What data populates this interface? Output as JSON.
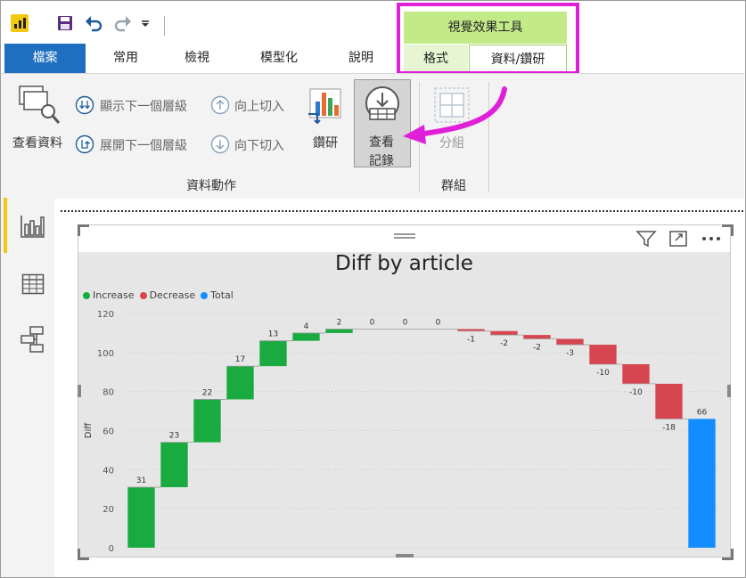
{
  "quick_access": {
    "save_icon": "save-icon",
    "undo_icon": "undo-icon",
    "redo_icon": "redo-icon"
  },
  "tabs": {
    "file": "檔案",
    "home": "常用",
    "view": "檢視",
    "modeling": "模型化",
    "help": "說明"
  },
  "context_tools": {
    "title": "視覺效果工具",
    "format_tab": "格式",
    "data_drill_tab": "資料/鑽研"
  },
  "ribbon": {
    "see_data": "查看資料",
    "show_next_level": "顯示下一個層級",
    "expand_next_level": "展開下一個層級",
    "drill_up": "向上切入",
    "drill_down": "向下切入",
    "drill": "鑽研",
    "see_records_1": "查看",
    "see_records_2": "記錄",
    "grouping": "分組",
    "group_data_actions": "資料動作",
    "group_groups": "群組"
  },
  "chart_data": {
    "type": "waterfall",
    "title": "Diff by article",
    "ylabel": "Diff",
    "xlabel": "",
    "ylim": [
      0,
      120
    ],
    "yticks": [
      0,
      20,
      40,
      60,
      80,
      100,
      120
    ],
    "grid": true,
    "legend_position": "top-left",
    "legend": [
      {
        "name": "Increase",
        "color": "#1aab40"
      },
      {
        "name": "Decrease",
        "color": "#d64550"
      },
      {
        "name": "Total",
        "color": "#118dff"
      }
    ],
    "values": [
      31,
      23,
      22,
      17,
      13,
      4,
      2,
      0,
      0,
      0,
      -1,
      -2,
      -2,
      -3,
      -10,
      -10,
      -18
    ],
    "total": 66,
    "labels": [
      "31",
      "23",
      "22",
      "17",
      "13",
      "4",
      "2",
      "0",
      "0",
      "0",
      "-1",
      "-2",
      "-2",
      "-3",
      "-10",
      "-10",
      "-18",
      "66"
    ]
  }
}
